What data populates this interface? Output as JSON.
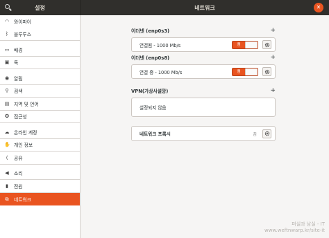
{
  "window": {
    "sidebar_title": "설정",
    "title": "네트워크",
    "close_symbol": "✕"
  },
  "sidebar": {
    "items": [
      {
        "label": "와이파이",
        "icon": "wifi-icon",
        "glyph": "◠"
      },
      {
        "label": "블루투스",
        "icon": "bluetooth-icon",
        "glyph": "ᛒ"
      },
      {
        "label": "배경",
        "icon": "background-icon",
        "glyph": "▭"
      },
      {
        "label": "독",
        "icon": "dock-icon",
        "glyph": "▣"
      },
      {
        "label": "알림",
        "icon": "notifications-icon",
        "glyph": "◉"
      },
      {
        "label": "검색",
        "icon": "search-icon",
        "glyph": "⚲"
      },
      {
        "label": "지역 및 언어",
        "icon": "region-icon",
        "glyph": "▤"
      },
      {
        "label": "접근성",
        "icon": "accessibility-icon",
        "glyph": "✪"
      },
      {
        "label": "온라인 계정",
        "icon": "online-accounts-icon",
        "glyph": "☁"
      },
      {
        "label": "개인 정보",
        "icon": "privacy-icon",
        "glyph": "✋"
      },
      {
        "label": "공유",
        "icon": "sharing-icon",
        "glyph": "⟨"
      },
      {
        "label": "소리",
        "icon": "sound-icon",
        "glyph": "◀"
      },
      {
        "label": "전원",
        "icon": "power-icon",
        "glyph": "▮"
      },
      {
        "label": "네트워크",
        "icon": "network-icon",
        "glyph": "⧉"
      }
    ],
    "active_index": 13
  },
  "sections": {
    "eth1": {
      "title": "이더넷 (enp0s3)",
      "add_symbol": "+",
      "status": "연결됨 - 1000 Mb/s",
      "switch_label": "켬"
    },
    "eth2": {
      "title": "이더넷 (enp0s8)",
      "add_symbol": "+",
      "status": "연결 중 - 1000 Mb/s",
      "switch_label": "켬"
    },
    "vpn": {
      "title": "VPN(가상사설망)",
      "add_symbol": "+",
      "empty": "설정되지 않음"
    },
    "proxy": {
      "label": "네트워크 프록시",
      "state": "끔"
    }
  },
  "watermark": {
    "line1": "퍼실과 남실 - IT",
    "line2": "www.weftnwarp.kr/site-it"
  },
  "colors": {
    "accent": "#e95420",
    "headerbar": "#302f2c"
  }
}
